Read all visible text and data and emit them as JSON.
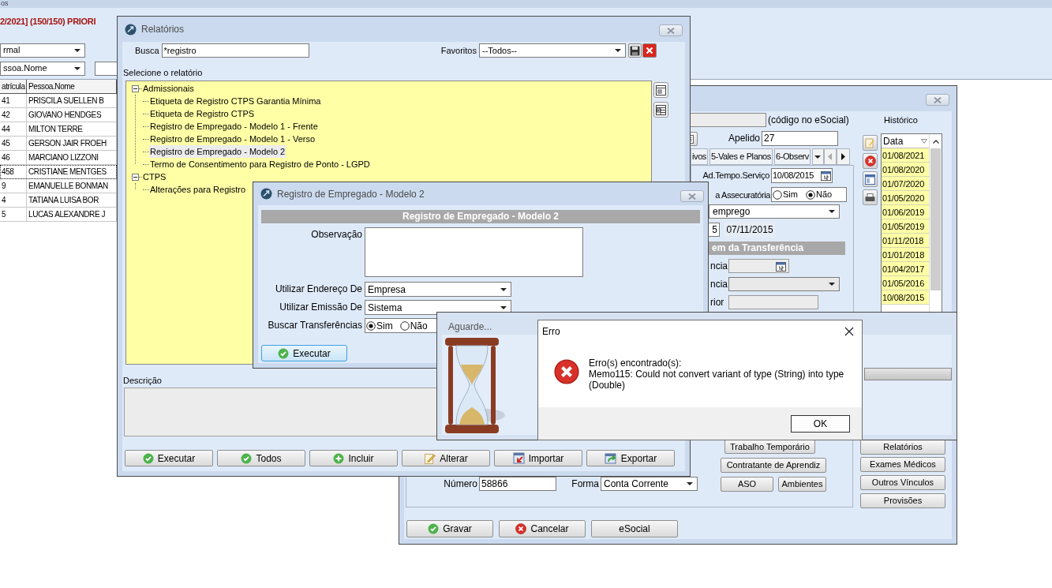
{
  "background_app": {
    "title_fragment": "os",
    "heading": "2/2021] (150/150) PRIORI",
    "dropdowns": [
      "rmal",
      "ssoa.Nome"
    ],
    "grid": {
      "columns": [
        "atrícula",
        "Pessoa.Nome"
      ],
      "rows": [
        {
          "cells": [
            "41",
            "PRISCILA SUELLEN B"
          ],
          "selected": false
        },
        {
          "cells": [
            "42",
            "GIOVANO HENDGES"
          ],
          "selected": false
        },
        {
          "cells": [
            "44",
            "MILTON TERRE"
          ],
          "selected": false
        },
        {
          "cells": [
            "45",
            "GERSON JAIR FROEH"
          ],
          "selected": false
        },
        {
          "cells": [
            "46",
            "MARCIANO LIZZONI"
          ],
          "selected": false
        },
        {
          "cells": [
            "458",
            "CRISTIANE MENTGES"
          ],
          "selected": true
        },
        {
          "cells": [
            "9",
            "EMANUELLE BONMAN"
          ],
          "selected": false
        },
        {
          "cells": [
            "4",
            "TATIANA LUISA BOR"
          ],
          "selected": false
        },
        {
          "cells": [
            "5",
            "LUCAS ALEXANDRE J"
          ],
          "selected": false
        }
      ]
    }
  },
  "employee_window": {
    "code_hint": "(código no eSocial)",
    "nickname": {
      "label": "Apelido",
      "value": "27"
    },
    "tabs": [
      {
        "label": "ivos",
        "selected": false
      },
      {
        "label": "5-Vales e Planos",
        "selected": false
      },
      {
        "label": "6-Observ",
        "selected": false
      }
    ],
    "service_date": {
      "label": "Ad.Tempo.Serviço",
      "value": "10/08/2015"
    },
    "assecuratoria": {
      "label": "a Assecuratória",
      "options": [
        {
          "label": "Sim",
          "selected": false
        },
        {
          "label": "Não",
          "selected": true
        }
      ]
    },
    "contract_type": "emprego",
    "date_fragment": "5",
    "end_date": "07/11/2015",
    "section_title": "em da Transferência",
    "transfer_fields": [
      {
        "label": "ncia",
        "kind": "date"
      },
      {
        "label": "ncia",
        "kind": "dropdown"
      },
      {
        "label": "rior",
        "kind": "text"
      }
    ],
    "history": {
      "title": "Histórico",
      "column": "Data",
      "dates": [
        "01/08/2021",
        "01/08/2020",
        "01/07/2020",
        "01/05/2020",
        "01/06/2019",
        "01/05/2019",
        "01/11/2018",
        "01/01/2018",
        "01/04/2017",
        "01/05/2016",
        "10/08/2015"
      ]
    },
    "account": {
      "number_label": "Número",
      "number": "58866",
      "form_label": "Forma",
      "form": "Conta Corrente"
    },
    "middle_buttons": [
      "Trabalho Temporário",
      "Contratante de Aprendiz",
      "ASO",
      "Ambientes"
    ],
    "right_buttons": [
      "Relatórios",
      "Exames Médicos",
      "Outros Vínculos",
      "Provisões"
    ],
    "footer_buttons": [
      {
        "label": "Gravar",
        "kind": "save"
      },
      {
        "label": "Cancelar",
        "kind": "cancel"
      },
      {
        "label": "eSocial",
        "kind": "plain"
      }
    ]
  },
  "reports_window": {
    "title": "Relatórios",
    "search": {
      "label": "Busca",
      "value": "*registro"
    },
    "favorites": {
      "label": "Favoritos",
      "value": "--Todos--"
    },
    "tree_label": "Selecione o relatório",
    "tree": [
      {
        "label": "Admissionais",
        "expanded": true,
        "children": [
          {
            "label": "Etiqueta de Registro CTPS Garantia Mínima",
            "selected": false
          },
          {
            "label": "Etiqueta de Registro CTPS",
            "selected": false
          },
          {
            "label": "Registro de Empregado - Modelo 1 - Frente",
            "selected": false
          },
          {
            "label": "Registro de Empregado - Modelo 1 - Verso",
            "selected": false
          },
          {
            "label": "Registro de Empregado - Modelo 2",
            "selected": true
          },
          {
            "label": "Termo de Consentimento para Registro de Ponto - LGPD",
            "selected": false
          }
        ]
      },
      {
        "label": "CTPS",
        "expanded": true,
        "children": [
          {
            "label": "Alterações para Registro",
            "selected": false
          }
        ]
      }
    ],
    "description_label": "Descrição",
    "buttons": [
      {
        "label": "Executar",
        "kind": "check"
      },
      {
        "label": "Todos",
        "kind": "check"
      },
      {
        "label": "Incluir",
        "kind": "add"
      },
      {
        "label": "Alterar",
        "kind": "edit"
      },
      {
        "label": "Importar",
        "kind": "import"
      },
      {
        "label": "Exportar",
        "kind": "export"
      }
    ]
  },
  "report_dialog": {
    "title": "Registro de Empregado - Modelo 2",
    "header": "Registro de Empregado - Modelo 2",
    "observation_label": "Observação",
    "address": {
      "label": "Utilizar Endereço De",
      "value": "Empresa"
    },
    "emission": {
      "label": "Utilizar Emissão De",
      "value": "Sistema"
    },
    "transfers": {
      "label": "Buscar Transferências",
      "options": [
        {
          "label": "Sim",
          "selected": true
        },
        {
          "label": "Não",
          "selected": false
        }
      ]
    },
    "button": "Executar"
  },
  "wait_window": {
    "title": "Aguarde...",
    "level": 0
  },
  "error_dialog": {
    "title": "Erro",
    "heading": "Erro(s) encontrado(s):",
    "message": "Memo115: Could not convert variant of type (String) into type (Double)",
    "button": "OK"
  }
}
